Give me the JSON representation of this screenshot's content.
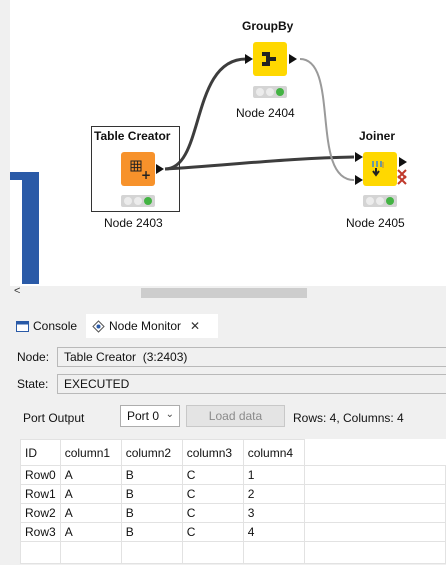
{
  "workflow": {
    "nodes": [
      {
        "id": "table-creator",
        "title": "Table Creator",
        "label": "Node 2403",
        "color": "#f7922b"
      },
      {
        "id": "groupby",
        "title": "GroupBy",
        "label": "Node 2404",
        "color": "#ffd800"
      },
      {
        "id": "joiner",
        "title": "Joiner",
        "label": "Node 2405",
        "color": "#ffd800"
      }
    ],
    "scroll_left_glyph": "<"
  },
  "tabs": [
    {
      "label": "Console",
      "icon": "console-icon"
    },
    {
      "label": "Node Monitor",
      "icon": "node-monitor-icon",
      "close": "✕"
    }
  ],
  "monitor": {
    "node_label": "Node:",
    "node_value": "Table Creator  (3:2403)",
    "state_label": "State:",
    "state_value": "EXECUTED",
    "port_output_label": "Port Output",
    "port_select_value": "Port 0",
    "load_button": "Load data",
    "summary": "Rows: 4, Columns: 4"
  },
  "table": {
    "headers": [
      "ID",
      "column1",
      "column2",
      "column3",
      "column4"
    ],
    "rows": [
      [
        "Row0",
        "A",
        "B",
        "C",
        "1"
      ],
      [
        "Row1",
        "A",
        "B",
        "C",
        "2"
      ],
      [
        "Row2",
        "A",
        "B",
        "C",
        "3"
      ],
      [
        "Row3",
        "A",
        "B",
        "C",
        "4"
      ]
    ]
  },
  "colors": {
    "accent_blue": "#2a5aa7",
    "status_green": "#43b343"
  }
}
